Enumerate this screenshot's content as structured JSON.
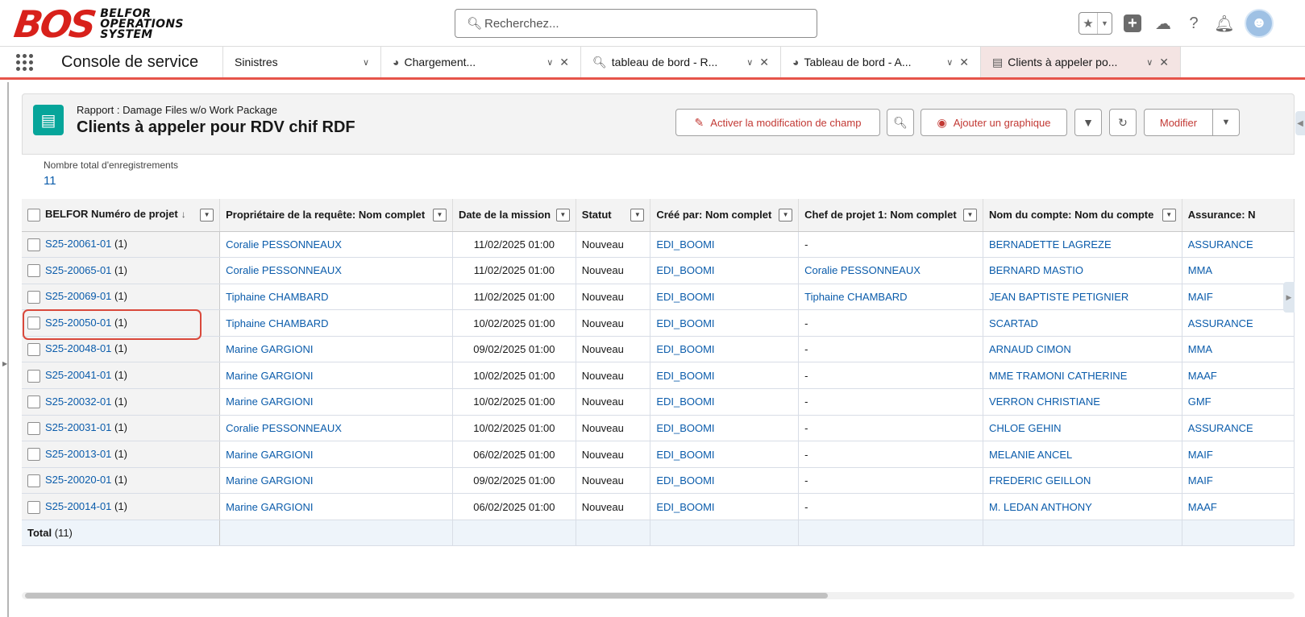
{
  "logo": {
    "mark": "BOS",
    "text": [
      "BELFOR",
      "OPERATIONS",
      "SYSTEM"
    ]
  },
  "search": {
    "placeholder": "Recherchez..."
  },
  "header_icons": [
    "star-icon",
    "add-icon",
    "trailhead-icon",
    "help-icon",
    "notification-bell-icon",
    "avatar"
  ],
  "app_name": "Console de service",
  "tabs": [
    {
      "label": "Sinistres",
      "icon": "",
      "closable": false
    },
    {
      "label": "Chargement...",
      "icon": "loading-icon",
      "closable": true
    },
    {
      "label": "tableau de bord - R...",
      "icon": "search-icon",
      "closable": true
    },
    {
      "label": "Tableau de bord - A...",
      "icon": "dashboard-icon",
      "closable": true
    },
    {
      "label": "Clients à appeler po...",
      "icon": "report-icon",
      "closable": true,
      "active": true
    }
  ],
  "report": {
    "type_label": "Rapport : Damage Files w/o Work Package",
    "title": "Clients à appeler pour RDV chif RDF",
    "buttons": {
      "enable_edit": "Activer la modification de champ",
      "add_chart": "Ajouter un graphique",
      "modify": "Modifier"
    },
    "total_records_label": "Nombre total d'enregistrements",
    "total_records_value": "11"
  },
  "table": {
    "columns": [
      "BELFOR Numéro de projet",
      "Propriétaire de la requête: Nom complet",
      "Date de la mission",
      "Statut",
      "Créé par: Nom complet",
      "Chef de projet 1: Nom complet",
      "Nom du compte: Nom du compte",
      "Assurance: N"
    ],
    "rows": [
      {
        "project": "S25-20061-01",
        "count": "(1)",
        "owner": "Coralie PESSONNEAUX",
        "date": "11/02/2025 01:00",
        "status": "Nouveau",
        "created_by": "EDI_BOOMI",
        "chef": "-",
        "account": "BERNADETTE LAGREZE",
        "insurance": "ASSURANCE"
      },
      {
        "project": "S25-20065-01",
        "count": "(1)",
        "owner": "Coralie PESSONNEAUX",
        "date": "11/02/2025 01:00",
        "status": "Nouveau",
        "created_by": "EDI_BOOMI",
        "chef": "Coralie PESSONNEAUX",
        "account": "BERNARD MASTIO",
        "insurance": "MMA"
      },
      {
        "project": "S25-20069-01",
        "count": "(1)",
        "owner": "Tiphaine CHAMBARD",
        "date": "11/02/2025 01:00",
        "status": "Nouveau",
        "created_by": "EDI_BOOMI",
        "chef": "Tiphaine CHAMBARD",
        "account": "JEAN BAPTISTE PETIGNIER",
        "insurance": "MAIF"
      },
      {
        "project": "S25-20050-01",
        "count": "(1)",
        "owner": "Tiphaine CHAMBARD",
        "date": "10/02/2025 01:00",
        "status": "Nouveau",
        "created_by": "EDI_BOOMI",
        "chef": "-",
        "account": "SCARTAD",
        "insurance": "ASSURANCE"
      },
      {
        "project": "S25-20048-01",
        "count": "(1)",
        "owner": "Marine GARGIONI",
        "date": "09/02/2025 01:00",
        "status": "Nouveau",
        "created_by": "EDI_BOOMI",
        "chef": "-",
        "account": "ARNAUD CIMON",
        "insurance": "MMA"
      },
      {
        "project": "S25-20041-01",
        "count": "(1)",
        "owner": "Marine GARGIONI",
        "date": "10/02/2025 01:00",
        "status": "Nouveau",
        "created_by": "EDI_BOOMI",
        "chef": "-",
        "account": "MME TRAMONI CATHERINE",
        "insurance": "MAAF"
      },
      {
        "project": "S25-20032-01",
        "count": "(1)",
        "owner": "Marine GARGIONI",
        "date": "10/02/2025 01:00",
        "status": "Nouveau",
        "created_by": "EDI_BOOMI",
        "chef": "-",
        "account": "VERRON CHRISTIANE",
        "insurance": "GMF"
      },
      {
        "project": "S25-20031-01",
        "count": "(1)",
        "owner": "Coralie PESSONNEAUX",
        "date": "10/02/2025 01:00",
        "status": "Nouveau",
        "created_by": "EDI_BOOMI",
        "chef": "-",
        "account": "CHLOE GEHIN",
        "insurance": "ASSURANCE"
      },
      {
        "project": "S25-20013-01",
        "count": "(1)",
        "owner": "Marine GARGIONI",
        "date": "06/02/2025 01:00",
        "status": "Nouveau",
        "created_by": "EDI_BOOMI",
        "chef": "-",
        "account": "MELANIE ANCEL",
        "insurance": "MAIF"
      },
      {
        "project": "S25-20020-01",
        "count": "(1)",
        "owner": "Marine GARGIONI",
        "date": "09/02/2025 01:00",
        "status": "Nouveau",
        "created_by": "EDI_BOOMI",
        "chef": "-",
        "account": "FREDERIC GEILLON",
        "insurance": "MAIF"
      },
      {
        "project": "S25-20014-01",
        "count": "(1)",
        "owner": "Marine GARGIONI",
        "date": "06/02/2025 01:00",
        "status": "Nouveau",
        "created_by": "EDI_BOOMI",
        "chef": "-",
        "account": "M. LEDAN ANTHONY",
        "insurance": "MAAF"
      }
    ],
    "total_label": "Total",
    "total_count": "(11)"
  },
  "colors": {
    "brand_red": "#d8211b",
    "link_blue": "#0b5cab",
    "report_icon_teal": "#06a59a",
    "highlight": "#d9483b"
  }
}
